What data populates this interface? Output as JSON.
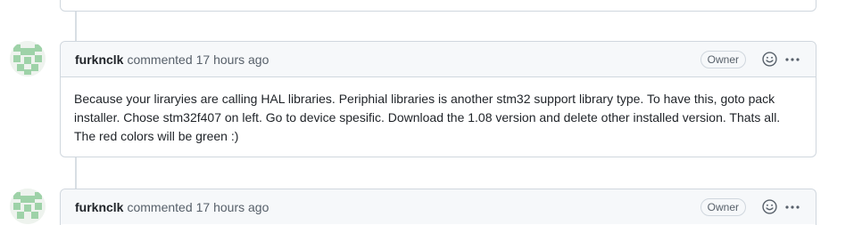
{
  "comments": [
    {
      "author": "furknclk",
      "action": "commented",
      "time": "17 hours ago",
      "badge": "Owner",
      "body": "Because your liraryies are calling HAL libraries. Periphial libraries is another stm32 support library type. To have this, goto pack installer. Chose stm32f407 on left. Go to device spesific. Download the 1.08 version and delete other installed version. Thats all. The red colors will be green :)"
    },
    {
      "author": "furknclk",
      "action": "commented",
      "time": "17 hours ago",
      "badge": "Owner",
      "body": ""
    }
  ],
  "icons": {
    "reaction": "smiley-icon",
    "menu": "kebab-horizontal-icon"
  },
  "colors": {
    "header_bg": "#f6f8fa",
    "border": "#d0d7de",
    "muted_text": "#57606a",
    "avatar_green": "#9ed2a8"
  }
}
